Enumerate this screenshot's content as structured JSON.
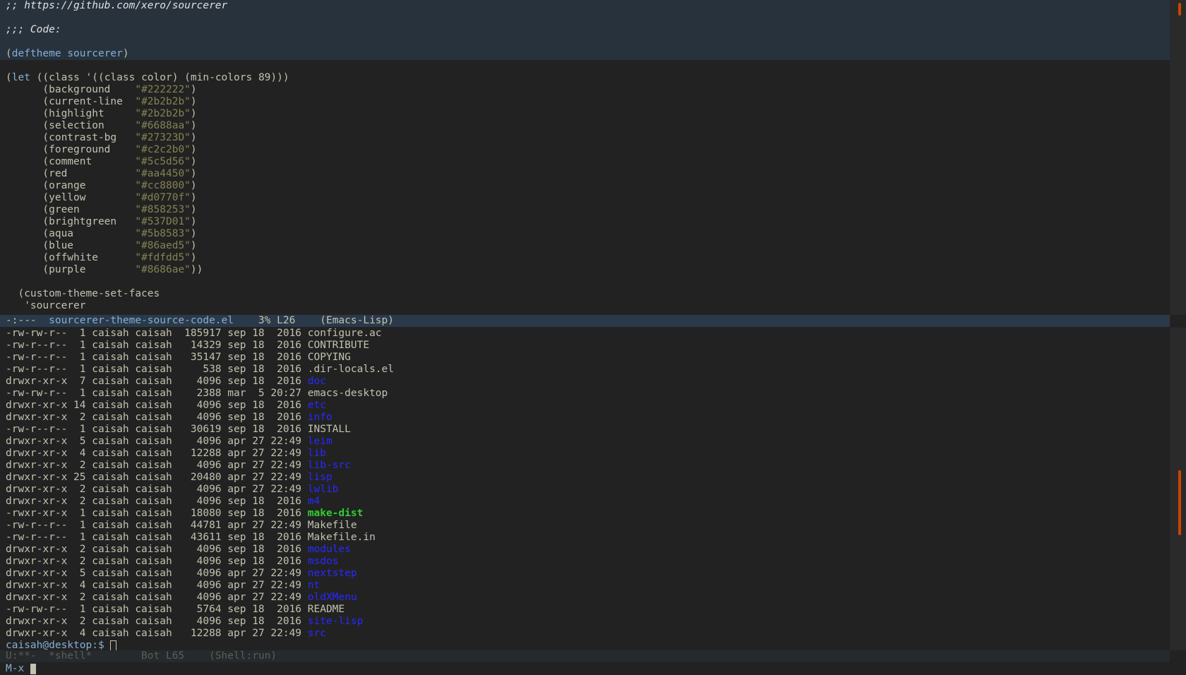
{
  "editor": {
    "header_lines": [
      {
        "text": ";; https://github.com/xero/sourcerer",
        "type": "comment"
      },
      {
        "text": "",
        "type": "blank"
      },
      {
        "text": ";;; Code:",
        "type": "comment"
      },
      {
        "text": "",
        "type": "blank"
      },
      {
        "open": "(",
        "kw": "deftheme",
        "sym": "sourcerer",
        "close": ")"
      }
    ],
    "let_line": "(let ((class '((class color) (min-colors 89)))",
    "let_kw": "let",
    "colors": [
      {
        "name": "background",
        "value": "\"#222222\")"
      },
      {
        "name": "current-line",
        "value": "\"#2b2b2b\")"
      },
      {
        "name": "highlight",
        "value": "\"#2b2b2b\")"
      },
      {
        "name": "selection",
        "value": "\"#6688aa\")"
      },
      {
        "name": "contrast-bg",
        "value": "\"#27323D\")"
      },
      {
        "name": "foreground",
        "value": "\"#c2c2b0\")"
      },
      {
        "name": "comment",
        "value": "\"#5c5d56\")"
      },
      {
        "name": "red",
        "value": "\"#aa4450\")"
      },
      {
        "name": "orange",
        "value": "\"#cc8800\")"
      },
      {
        "name": "yellow",
        "value": "\"#d0770f\")"
      },
      {
        "name": "green",
        "value": "\"#858253\")"
      },
      {
        "name": "brightgreen",
        "value": "\"#537D01\")"
      },
      {
        "name": "aqua",
        "value": "\"#5b8583\")"
      },
      {
        "name": "blue",
        "value": "\"#86aed5\")"
      },
      {
        "name": "offwhite",
        "value": "\"#fdfdd5\")"
      },
      {
        "name": "purple",
        "value": "\"#8686ae\"))"
      }
    ],
    "tail_lines": [
      "",
      "  (custom-theme-set-faces",
      "   'sourcerer"
    ]
  },
  "modeline_top": {
    "status": "-:---  ",
    "buffer": "sourcerer-theme-source-code.el",
    "position": "    3% L26    ",
    "mode": "(Emacs-Lisp)"
  },
  "shell": {
    "listing": [
      {
        "perm": "-rw-rw-r--",
        "links": " 1",
        "owner": "caisah",
        "group": "caisah",
        "size": "185917",
        "date": "sep 18  2016",
        "name": "configure.ac",
        "kind": "file"
      },
      {
        "perm": "-rw-r--r--",
        "links": " 1",
        "owner": "caisah",
        "group": "caisah",
        "size": "14329",
        "date": "sep 18  2016",
        "name": "CONTRIBUTE",
        "kind": "file"
      },
      {
        "perm": "-rw-r--r--",
        "links": " 1",
        "owner": "caisah",
        "group": "caisah",
        "size": "35147",
        "date": "sep 18  2016",
        "name": "COPYING",
        "kind": "file"
      },
      {
        "perm": "-rw-r--r--",
        "links": " 1",
        "owner": "caisah",
        "group": "caisah",
        "size": "538",
        "date": "sep 18  2016",
        "name": ".dir-locals.el",
        "kind": "file"
      },
      {
        "perm": "drwxr-xr-x",
        "links": " 7",
        "owner": "caisah",
        "group": "caisah",
        "size": "4096",
        "date": "sep 18  2016",
        "name": "doc",
        "kind": "dir"
      },
      {
        "perm": "-rw-rw-r--",
        "links": " 1",
        "owner": "caisah",
        "group": "caisah",
        "size": "2388",
        "date": "mar  5 20:27",
        "name": "emacs-desktop",
        "kind": "file"
      },
      {
        "perm": "drwxr-xr-x",
        "links": "14",
        "owner": "caisah",
        "group": "caisah",
        "size": "4096",
        "date": "sep 18  2016",
        "name": "etc",
        "kind": "dir"
      },
      {
        "perm": "drwxr-xr-x",
        "links": " 2",
        "owner": "caisah",
        "group": "caisah",
        "size": "4096",
        "date": "sep 18  2016",
        "name": "info",
        "kind": "dir"
      },
      {
        "perm": "-rw-r--r--",
        "links": " 1",
        "owner": "caisah",
        "group": "caisah",
        "size": "30619",
        "date": "sep 18  2016",
        "name": "INSTALL",
        "kind": "file"
      },
      {
        "perm": "drwxr-xr-x",
        "links": " 5",
        "owner": "caisah",
        "group": "caisah",
        "size": "4096",
        "date": "apr 27 22:49",
        "name": "leim",
        "kind": "dir"
      },
      {
        "perm": "drwxr-xr-x",
        "links": " 4",
        "owner": "caisah",
        "group": "caisah",
        "size": "12288",
        "date": "apr 27 22:49",
        "name": "lib",
        "kind": "dir"
      },
      {
        "perm": "drwxr-xr-x",
        "links": " 2",
        "owner": "caisah",
        "group": "caisah",
        "size": "4096",
        "date": "apr 27 22:49",
        "name": "lib-src",
        "kind": "dir"
      },
      {
        "perm": "drwxr-xr-x",
        "links": "25",
        "owner": "caisah",
        "group": "caisah",
        "size": "20480",
        "date": "apr 27 22:49",
        "name": "lisp",
        "kind": "dir"
      },
      {
        "perm": "drwxr-xr-x",
        "links": " 2",
        "owner": "caisah",
        "group": "caisah",
        "size": "4096",
        "date": "apr 27 22:49",
        "name": "lwlib",
        "kind": "dir"
      },
      {
        "perm": "drwxr-xr-x",
        "links": " 2",
        "owner": "caisah",
        "group": "caisah",
        "size": "4096",
        "date": "sep 18  2016",
        "name": "m4",
        "kind": "dir"
      },
      {
        "perm": "-rwxr-xr-x",
        "links": " 1",
        "owner": "caisah",
        "group": "caisah",
        "size": "18080",
        "date": "sep 18  2016",
        "name": "make-dist",
        "kind": "exe"
      },
      {
        "perm": "-rw-r--r--",
        "links": " 1",
        "owner": "caisah",
        "group": "caisah",
        "size": "44781",
        "date": "apr 27 22:49",
        "name": "Makefile",
        "kind": "file"
      },
      {
        "perm": "-rw-r--r--",
        "links": " 1",
        "owner": "caisah",
        "group": "caisah",
        "size": "43611",
        "date": "sep 18  2016",
        "name": "Makefile.in",
        "kind": "file"
      },
      {
        "perm": "drwxr-xr-x",
        "links": " 2",
        "owner": "caisah",
        "group": "caisah",
        "size": "4096",
        "date": "sep 18  2016",
        "name": "modules",
        "kind": "dir"
      },
      {
        "perm": "drwxr-xr-x",
        "links": " 2",
        "owner": "caisah",
        "group": "caisah",
        "size": "4096",
        "date": "sep 18  2016",
        "name": "msdos",
        "kind": "dir"
      },
      {
        "perm": "drwxr-xr-x",
        "links": " 5",
        "owner": "caisah",
        "group": "caisah",
        "size": "4096",
        "date": "apr 27 22:49",
        "name": "nextstep",
        "kind": "dir"
      },
      {
        "perm": "drwxr-xr-x",
        "links": " 4",
        "owner": "caisah",
        "group": "caisah",
        "size": "4096",
        "date": "apr 27 22:49",
        "name": "nt",
        "kind": "dir"
      },
      {
        "perm": "drwxr-xr-x",
        "links": " 2",
        "owner": "caisah",
        "group": "caisah",
        "size": "4096",
        "date": "apr 27 22:49",
        "name": "oldXMenu",
        "kind": "dir"
      },
      {
        "perm": "-rw-rw-r--",
        "links": " 1",
        "owner": "caisah",
        "group": "caisah",
        "size": "5764",
        "date": "sep 18  2016",
        "name": "README",
        "kind": "file"
      },
      {
        "perm": "drwxr-xr-x",
        "links": " 2",
        "owner": "caisah",
        "group": "caisah",
        "size": "4096",
        "date": "sep 18  2016",
        "name": "site-lisp",
        "kind": "dir"
      },
      {
        "perm": "drwxr-xr-x",
        "links": " 4",
        "owner": "caisah",
        "group": "caisah",
        "size": "12288",
        "date": "apr 27 22:49",
        "name": "src",
        "kind": "dir"
      }
    ],
    "prompt": "caisah@desktop:$ "
  },
  "modeline_bottom": {
    "status": "U:**-  ",
    "buffer": "*shell*",
    "position": "        Bot L65    ",
    "mode": "(Shell:run)"
  },
  "minibuffer": {
    "text": "M-x "
  },
  "colors": {
    "background": "#222222",
    "foreground": "#c2c2b0",
    "contrast_bg": "#27323d",
    "blue": "#86aed5",
    "green_string": "#858253",
    "dir": "#2929ff",
    "exe": "#32cd32",
    "scroll_thumb": "#cc4400"
  }
}
